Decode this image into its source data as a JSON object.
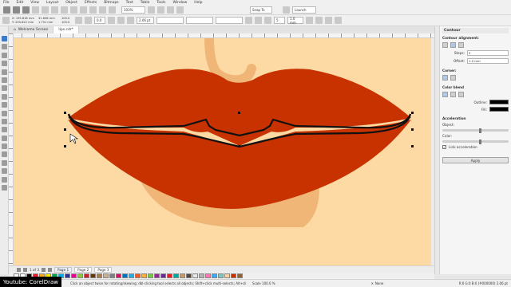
{
  "menu": [
    "File",
    "Edit",
    "View",
    "Layout",
    "Object",
    "Effects",
    "Bitmaps",
    "Text",
    "Table",
    "Tools",
    "Window",
    "Help"
  ],
  "std_toolbar": {
    "zoom_value": "103%",
    "snap_to": "Snap To",
    "launch": "Launch"
  },
  "prop_bar": {
    "x": "X: 195.818 mm",
    "y": "Y: 250.822 mm",
    "w": "31.838 mm",
    "h": "1.751 mm",
    "scale_w": "100.0",
    "scale_h": "100.0",
    "angle": "0.0",
    "outline_width": "2.06 pt",
    "steps": "5",
    "offset": "1.0 mm"
  },
  "doc_tabs": {
    "welcome": "Welcome Screen",
    "file": "lips.cdr*"
  },
  "page_nav": {
    "counter": "1 of 3",
    "pages": [
      "Page 1",
      "Page 2",
      "Page 3"
    ]
  },
  "palette_colors": [
    "#ffffff",
    "#000000",
    "#e31e24",
    "#f7a823",
    "#fff200",
    "#00a651",
    "#00aeef",
    "#2e3192",
    "#ec008c",
    "#8dc63f",
    "#c1272d",
    "#603913",
    "#a67c52",
    "#c7b299",
    "#808080",
    "#d4145a",
    "#0071bc",
    "#29abe2",
    "#f15a24",
    "#fbb03b",
    "#7ac943",
    "#93278f",
    "#662d91",
    "#ed1c24",
    "#00a99d",
    "#c69c6d",
    "#534741",
    "#e6e6e6",
    "#b3b3b3",
    "#ff7bac",
    "#3fa9f5",
    "#7fc6bc",
    "#f4d0a4",
    "#c83200",
    "#8c6239"
  ],
  "status": {
    "hint": "Click an object twice for rotating/skewing; dbl-clicking tool selects all objects; Shift+click multi-selects; Alt+click digs; Ctrl+click selects in a group",
    "scale": "Scale 100.0 %",
    "fill": "None",
    "color_info": "R:0 G:0 B:0 (#000000)  2.06 pt"
  },
  "watermark": "Youtube: CorelDraw",
  "docker": {
    "title": "Contour",
    "alignment_label": "Contour alignment:",
    "steps_label": "Steps:",
    "offset_label": "Offset:",
    "corner_label": "Corner:",
    "color_blend_label": "Color blend",
    "outline_label": "Outline:",
    "fill_label": "Fill:",
    "acceleration_label": "Acceleration",
    "object_label": "Object:",
    "color_label": "Color:",
    "link_label": "Link acceleration",
    "apply_label": "Apply"
  },
  "colors": {
    "canvas_bg": "#fdd9a3",
    "lip": "#c83200",
    "shadow": "#f0b677",
    "accent": "#3d78c9"
  }
}
